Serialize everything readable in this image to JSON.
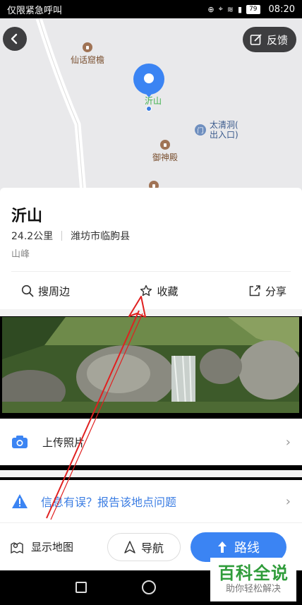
{
  "status_bar": {
    "carrier": "仅限紧急呼叫",
    "battery": "79",
    "time": "08:20"
  },
  "map": {
    "back_icon": "chevron-left-icon",
    "feedback_label": "反馈",
    "pois": [
      {
        "label": "仙话窟檐"
      },
      {
        "label": "御神殿"
      }
    ],
    "entrance_label_line1": "太清洞(",
    "entrance_label_line2": "出入口)",
    "pin_label": "沂山"
  },
  "place": {
    "name": "沂山",
    "distance": "24.2公里",
    "location": "潍坊市临朐县",
    "category": "山峰"
  },
  "actions": {
    "nearby": "搜周边",
    "favorite": "收藏",
    "share": "分享"
  },
  "rows": {
    "upload_photo": "上传照片",
    "report_issue": "信息有误？报告该地点问题"
  },
  "bottom_bar": {
    "show_map": "显示地图",
    "navigate": "导航",
    "route": "路线"
  },
  "watermark": {
    "title": "百科全说",
    "subtitle": "助你轻松解决"
  },
  "colors": {
    "accent": "#3b84f3",
    "link": "#3b7de3",
    "annotation": "#e02020",
    "watermark_green": "#2f9c3a"
  }
}
